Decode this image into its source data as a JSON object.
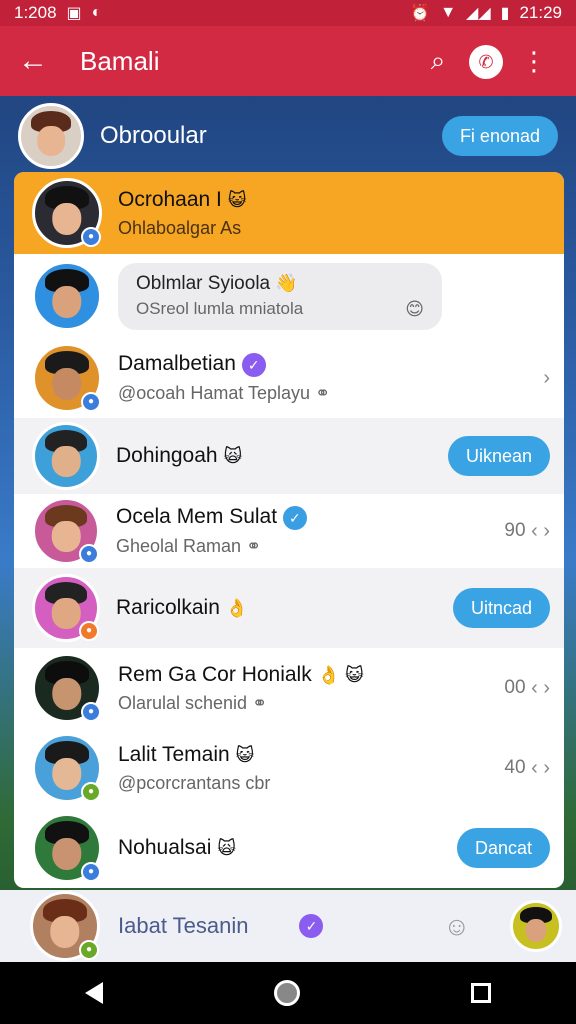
{
  "status_bar": {
    "time": "1:208",
    "clock": "21:29"
  },
  "app_bar": {
    "title": "Bamali",
    "back_icon": "arrow-left-icon",
    "search_icon": "search-icon",
    "chat_icon": "chat-bubble-icon",
    "more_icon": "more-vert-icon"
  },
  "header": {
    "title": "Obrooular",
    "button_label": "Fi enonad"
  },
  "contacts": [
    {
      "name": "Ocrohaan I",
      "sub": "Ohlaboalgar As"
    },
    {
      "name": "Oblmlar Syioola",
      "sub": "OSreol lumla mniatola"
    },
    {
      "name": "Damalbetian",
      "sub": "@ocoah Hamat Teplayu"
    },
    {
      "name": "Dohingoah",
      "button": "Uiknean"
    },
    {
      "name": "Ocela Mem Sulat",
      "sub": "Gheolal Raman",
      "meta": "90"
    },
    {
      "name": "Raricolkain",
      "button": "Uitncad"
    },
    {
      "name": "Rem Ga Cor Honialk",
      "sub": "Olarulal schenid",
      "meta": "00"
    },
    {
      "name": "Lalit Temain",
      "sub": "@pcorcrantans cbr",
      "meta": "40"
    },
    {
      "name": "Nohualsai",
      "button": "Dancat"
    }
  ],
  "bottom": {
    "name": "Iabat Tesanin"
  },
  "colors": {
    "appbar": "#d32a44",
    "accent": "#3aa3e3",
    "highlight": "#f6a623"
  }
}
